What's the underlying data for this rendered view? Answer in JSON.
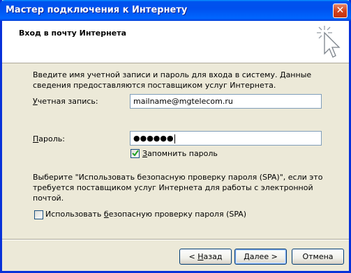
{
  "window": {
    "title": "Мастер подключения к Интернету",
    "close_glyph": "✕"
  },
  "header": {
    "title": "Вход в почту Интернета",
    "icon": "wizard-wand-icon"
  },
  "intro_text": "Введите имя учетной записи и пароль для входа в систему. Данные сведения предоставляются поставщиком услуг Интернета.",
  "account": {
    "label_prefix": "У",
    "label_rest": "четная запись:",
    "value": "mailname@mgtelecom.ru"
  },
  "password": {
    "label_prefix": "П",
    "label_rest": "ароль:",
    "value_masked": "●●●●●●"
  },
  "remember": {
    "label_prefix": "З",
    "label_rest": "апомнить пароль",
    "checked": true
  },
  "spa_info": "Выберите \"Использовать безопасную проверку пароля (SPA)\", если это требуется поставщиком услуг Интернета для работы с электронной почтой.",
  "spa_checkbox": {
    "label_part1": "Использовать ",
    "label_underlined": "б",
    "label_part2": "езопасную проверку пароля (SPA)",
    "checked": false
  },
  "buttons": {
    "back_prefix": "< ",
    "back_underlined": "Н",
    "back_rest": "азад",
    "next_underlined": "Д",
    "next_rest": "алее >",
    "cancel": "Отмена"
  }
}
